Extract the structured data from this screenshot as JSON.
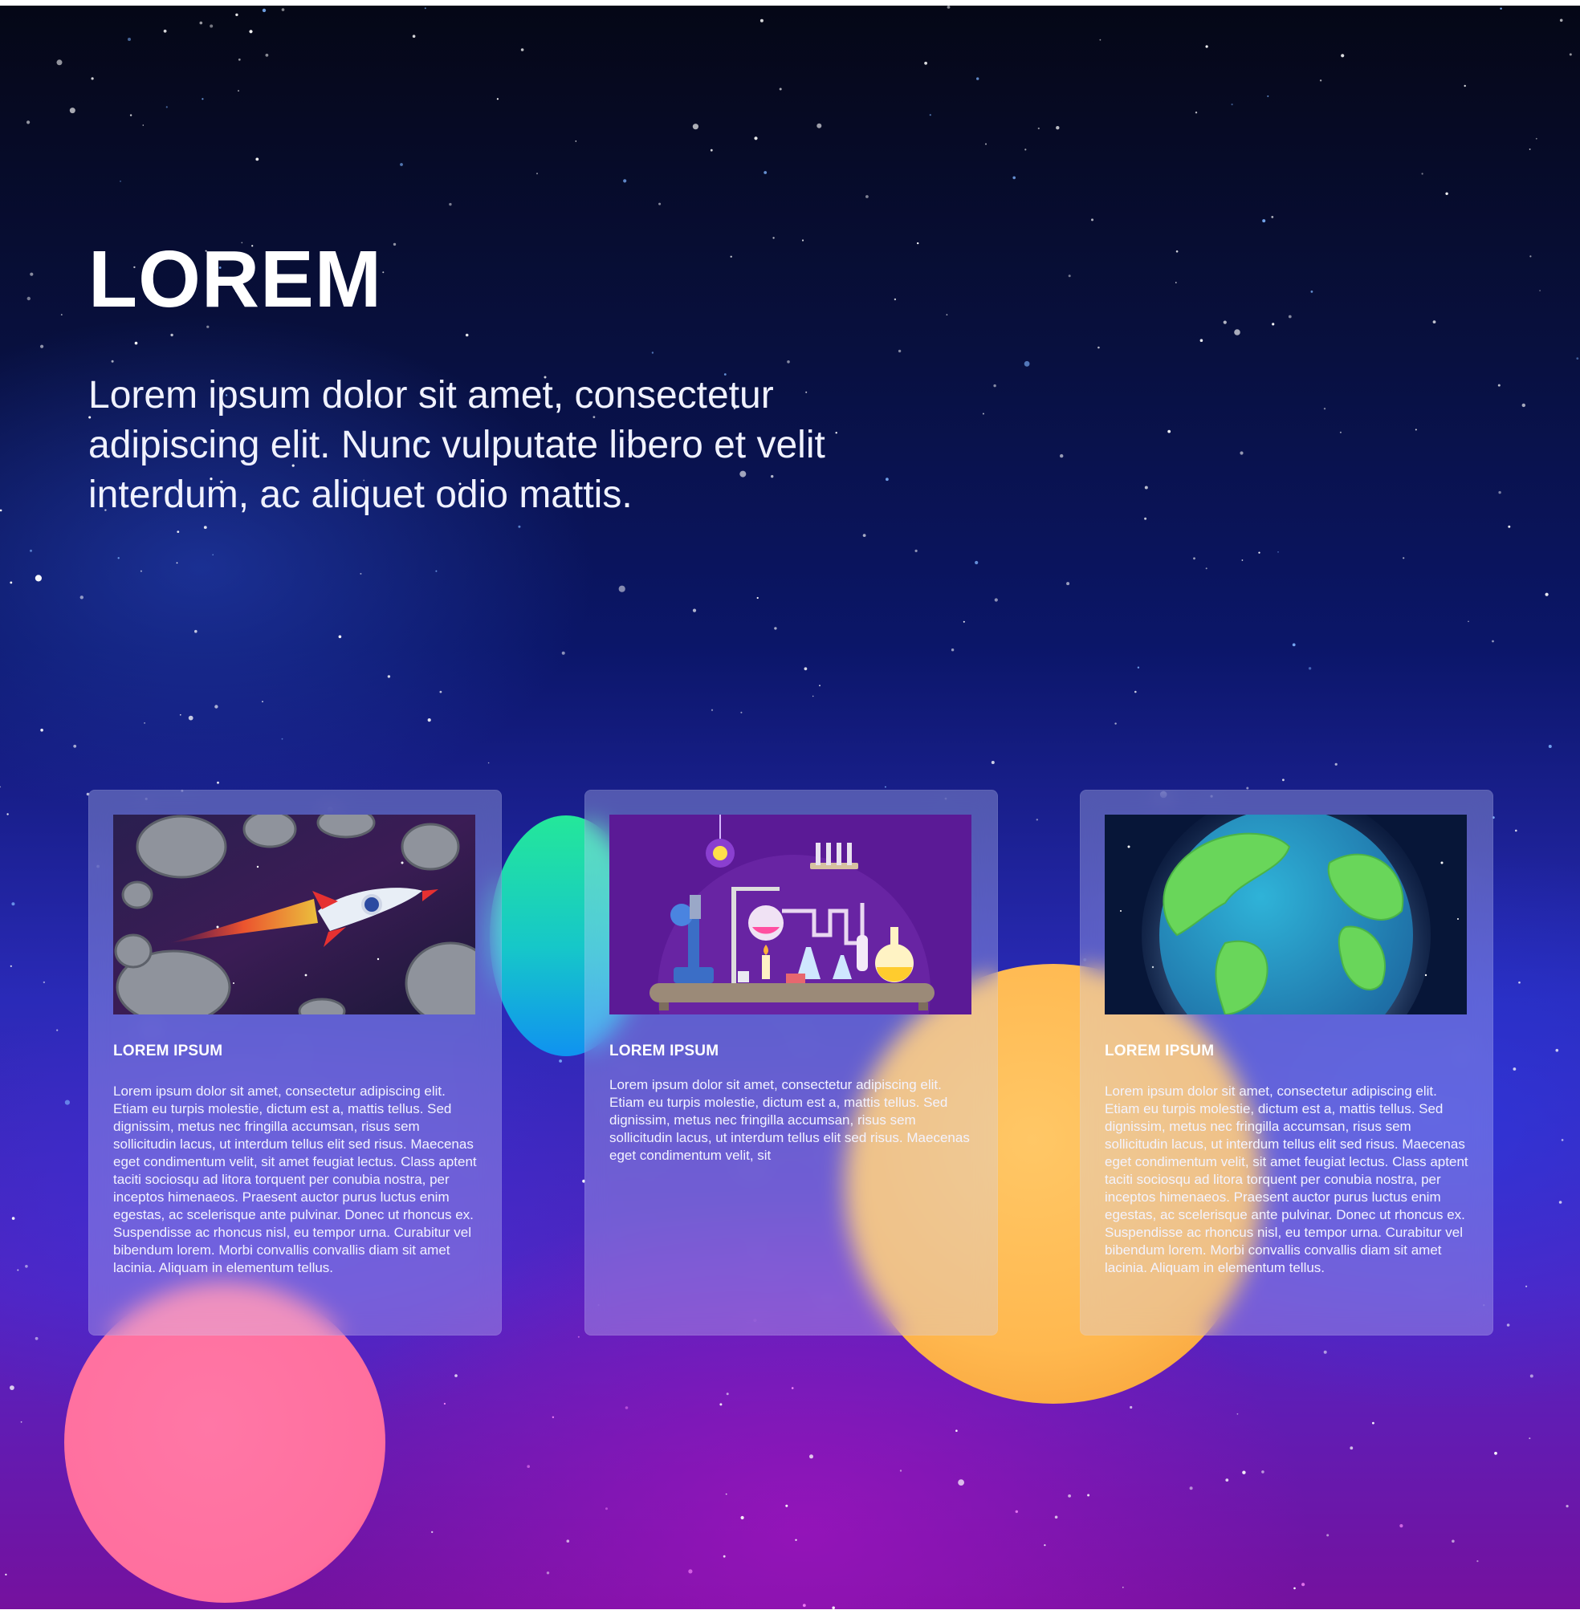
{
  "hero": {
    "title": "LOREM",
    "description": "Lorem ipsum dolor sit amet, consectetur adipiscing elit. Nunc vulputate libero et velit interdum, ac aliquet odio mattis."
  },
  "cards": [
    {
      "image": "rocket-among-asteroids-illustration",
      "title": "LOREM IPSUM",
      "text": "Lorem ipsum dolor sit amet, consectetur adipiscing elit. Etiam eu turpis molestie, dictum est a, mattis tellus. Sed dignissim, metus nec fringilla accumsan, risus sem sollicitudin lacus, ut interdum tellus elit sed risus. Maecenas eget condimentum velit, sit amet feugiat lectus. Class aptent taciti sociosqu ad litora torquent per conubia nostra, per inceptos himenaeos. Praesent auctor purus luctus enim egestas, ac scelerisque ante pulvinar. Donec ut rhoncus ex. Suspendisse ac rhoncus nisl, eu tempor urna. Curabitur vel bibendum lorem. Morbi convallis convallis diam sit amet lacinia. Aliquam in elementum tellus."
    },
    {
      "image": "chemistry-lab-illustration",
      "title": "LOREM IPSUM",
      "text": "Lorem ipsum dolor sit amet, consectetur adipiscing elit. Etiam eu turpis molestie, dictum est a, mattis tellus. Sed dignissim, metus nec fringilla accumsan, risus sem sollicitudin lacus, ut interdum tellus elit sed risus. Maecenas eget condimentum velit, sit"
    },
    {
      "image": "earth-globe-illustration",
      "title": "LOREM IPSUM",
      "text": "Lorem ipsum dolor sit amet, consectetur adipiscing elit. Etiam eu turpis molestie, dictum est a, mattis tellus. Sed dignissim, metus nec fringilla accumsan, risus sem sollicitudin lacus, ut interdum tellus elit sed risus. Maecenas eget condimentum velit, sit amet feugiat lectus. Class aptent taciti sociosqu ad litora torquent per conubia nostra, per inceptos himenaeos. Praesent auctor purus luctus enim egestas, ac scelerisque ante pulvinar. Donec ut rhoncus ex. Suspendisse ac rhoncus nisl, eu tempor urna. Curabitur vel bibendum lorem. Morbi convallis convallis diam sit amet lacinia. Aliquam in elementum tellus."
    }
  ],
  "colors": {
    "space_top": "#050716",
    "space_bottom": "#75119e",
    "planet_green": "#24e79a",
    "planet_orange": "#ffb84f",
    "planet_pink": "#ff6f9e"
  }
}
